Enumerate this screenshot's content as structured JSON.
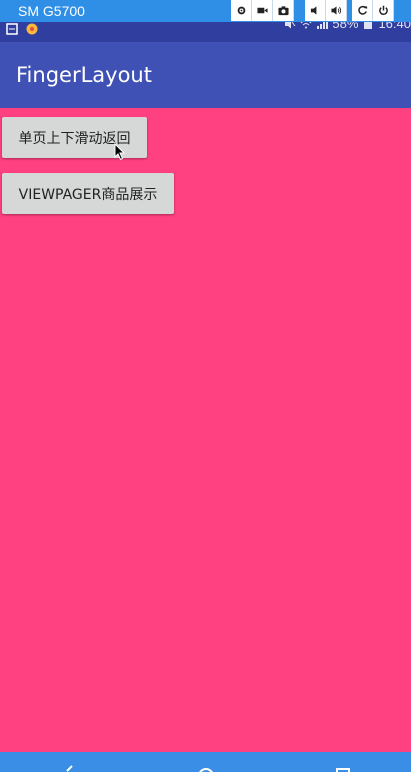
{
  "emulator": {
    "device_name": "SM G5700",
    "tools": [
      "gear-icon",
      "video-camera-icon",
      "camera-icon",
      "volume-down-icon",
      "volume-up-icon",
      "rotate-icon",
      "power-icon"
    ]
  },
  "status_bar": {
    "battery": "58%",
    "time": "16:40"
  },
  "app_bar": {
    "title": "FingerLayout"
  },
  "buttons": {
    "single_page_label": "单页上下滑动返回",
    "viewpager_label": "VIEWPAGER商品展示"
  },
  "colors": {
    "emulator_bar": "#2f8fe6",
    "status_bar": "#303f9f",
    "app_bar": "#3f51b5",
    "content_background": "#ff4081",
    "button_background": "#d6d7d7",
    "nav_bar": "#3a8ee6"
  },
  "nav_bar": {
    "items": [
      "back-icon",
      "home-icon",
      "recents-icon"
    ]
  }
}
